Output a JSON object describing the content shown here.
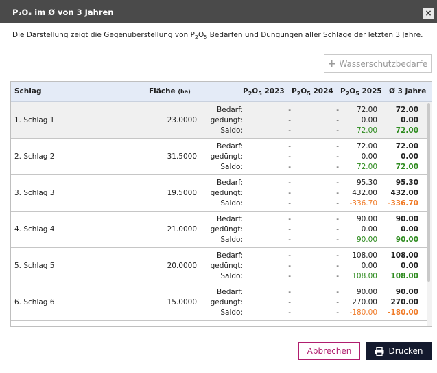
{
  "dialog": {
    "title": "P₂O₅ im Ø von 3 Jahren",
    "intro_pre": "Die Darstellung zeigt die Gegenüberstellung von P",
    "intro_sub1": "2",
    "intro_mid": "O",
    "intro_sub2": "5",
    "intro_post": " Bedarfen und Düngungen aller Schläge der letzten 3 Jahre.",
    "close_icon": "×"
  },
  "toolbar": {
    "wasserschutz_label": "Wasserschutzbedarfe",
    "plus_icon": "+"
  },
  "table": {
    "headers": {
      "schlag": "Schlag",
      "flaeche": "Fläche",
      "flaeche_unit": "(ha)",
      "p2o5_prefix": "P",
      "p2o5_sub1": "2",
      "p2o5_o": "O",
      "p2o5_sub2": "5",
      "y2023": " 2023",
      "y2024": " 2024",
      "y2025": " 2025",
      "avg": "Ø 3 Jahre"
    },
    "row_labels": {
      "bedarf": "Bedarf:",
      "geduengt": "gedüngt:",
      "saldo": "Saldo:"
    },
    "rows": [
      {
        "name": "1. Schlag 1",
        "area": "23.0000",
        "y2023": [
          "-",
          "-",
          "-"
        ],
        "y2024": [
          "-",
          "-",
          "-"
        ],
        "y2025": [
          "72.00",
          "0.00",
          "72.00"
        ],
        "avg": [
          "72.00",
          "0.00",
          "72.00"
        ],
        "saldo_sign": "pos"
      },
      {
        "name": "2. Schlag 2",
        "area": "31.5000",
        "y2023": [
          "-",
          "-",
          "-"
        ],
        "y2024": [
          "-",
          "-",
          "-"
        ],
        "y2025": [
          "72.00",
          "0.00",
          "72.00"
        ],
        "avg": [
          "72.00",
          "0.00",
          "72.00"
        ],
        "saldo_sign": "pos"
      },
      {
        "name": "3. Schlag 3",
        "area": "19.5000",
        "y2023": [
          "-",
          "-",
          "-"
        ],
        "y2024": [
          "-",
          "-",
          "-"
        ],
        "y2025": [
          "95.30",
          "432.00",
          "-336.70"
        ],
        "avg": [
          "95.30",
          "432.00",
          "-336.70"
        ],
        "saldo_sign": "neg"
      },
      {
        "name": "4. Schlag 4",
        "area": "21.0000",
        "y2023": [
          "-",
          "-",
          "-"
        ],
        "y2024": [
          "-",
          "-",
          "-"
        ],
        "y2025": [
          "90.00",
          "0.00",
          "90.00"
        ],
        "avg": [
          "90.00",
          "0.00",
          "90.00"
        ],
        "saldo_sign": "pos"
      },
      {
        "name": "5. Schlag 5",
        "area": "20.0000",
        "y2023": [
          "-",
          "-",
          "-"
        ],
        "y2024": [
          "-",
          "-",
          "-"
        ],
        "y2025": [
          "108.00",
          "0.00",
          "108.00"
        ],
        "avg": [
          "108.00",
          "0.00",
          "108.00"
        ],
        "saldo_sign": "pos"
      },
      {
        "name": "6. Schlag 6",
        "area": "15.0000",
        "y2023": [
          "-",
          "-",
          "-"
        ],
        "y2024": [
          "-",
          "-",
          "-"
        ],
        "y2025": [
          "90.00",
          "270.00",
          "-180.00"
        ],
        "avg": [
          "90.00",
          "270.00",
          "-180.00"
        ],
        "saldo_sign": "neg"
      }
    ]
  },
  "footer": {
    "cancel_label": "Abbrechen",
    "print_label": "Drucken",
    "print_icon": "printer-icon"
  },
  "colors": {
    "titlebar": "#4a4a4a",
    "header_bg": "#e4ebf7",
    "positive": "#2e8b1f",
    "negative": "#f07b28",
    "cancel_accent": "#b01e6e",
    "print_bg": "#141a2e"
  }
}
